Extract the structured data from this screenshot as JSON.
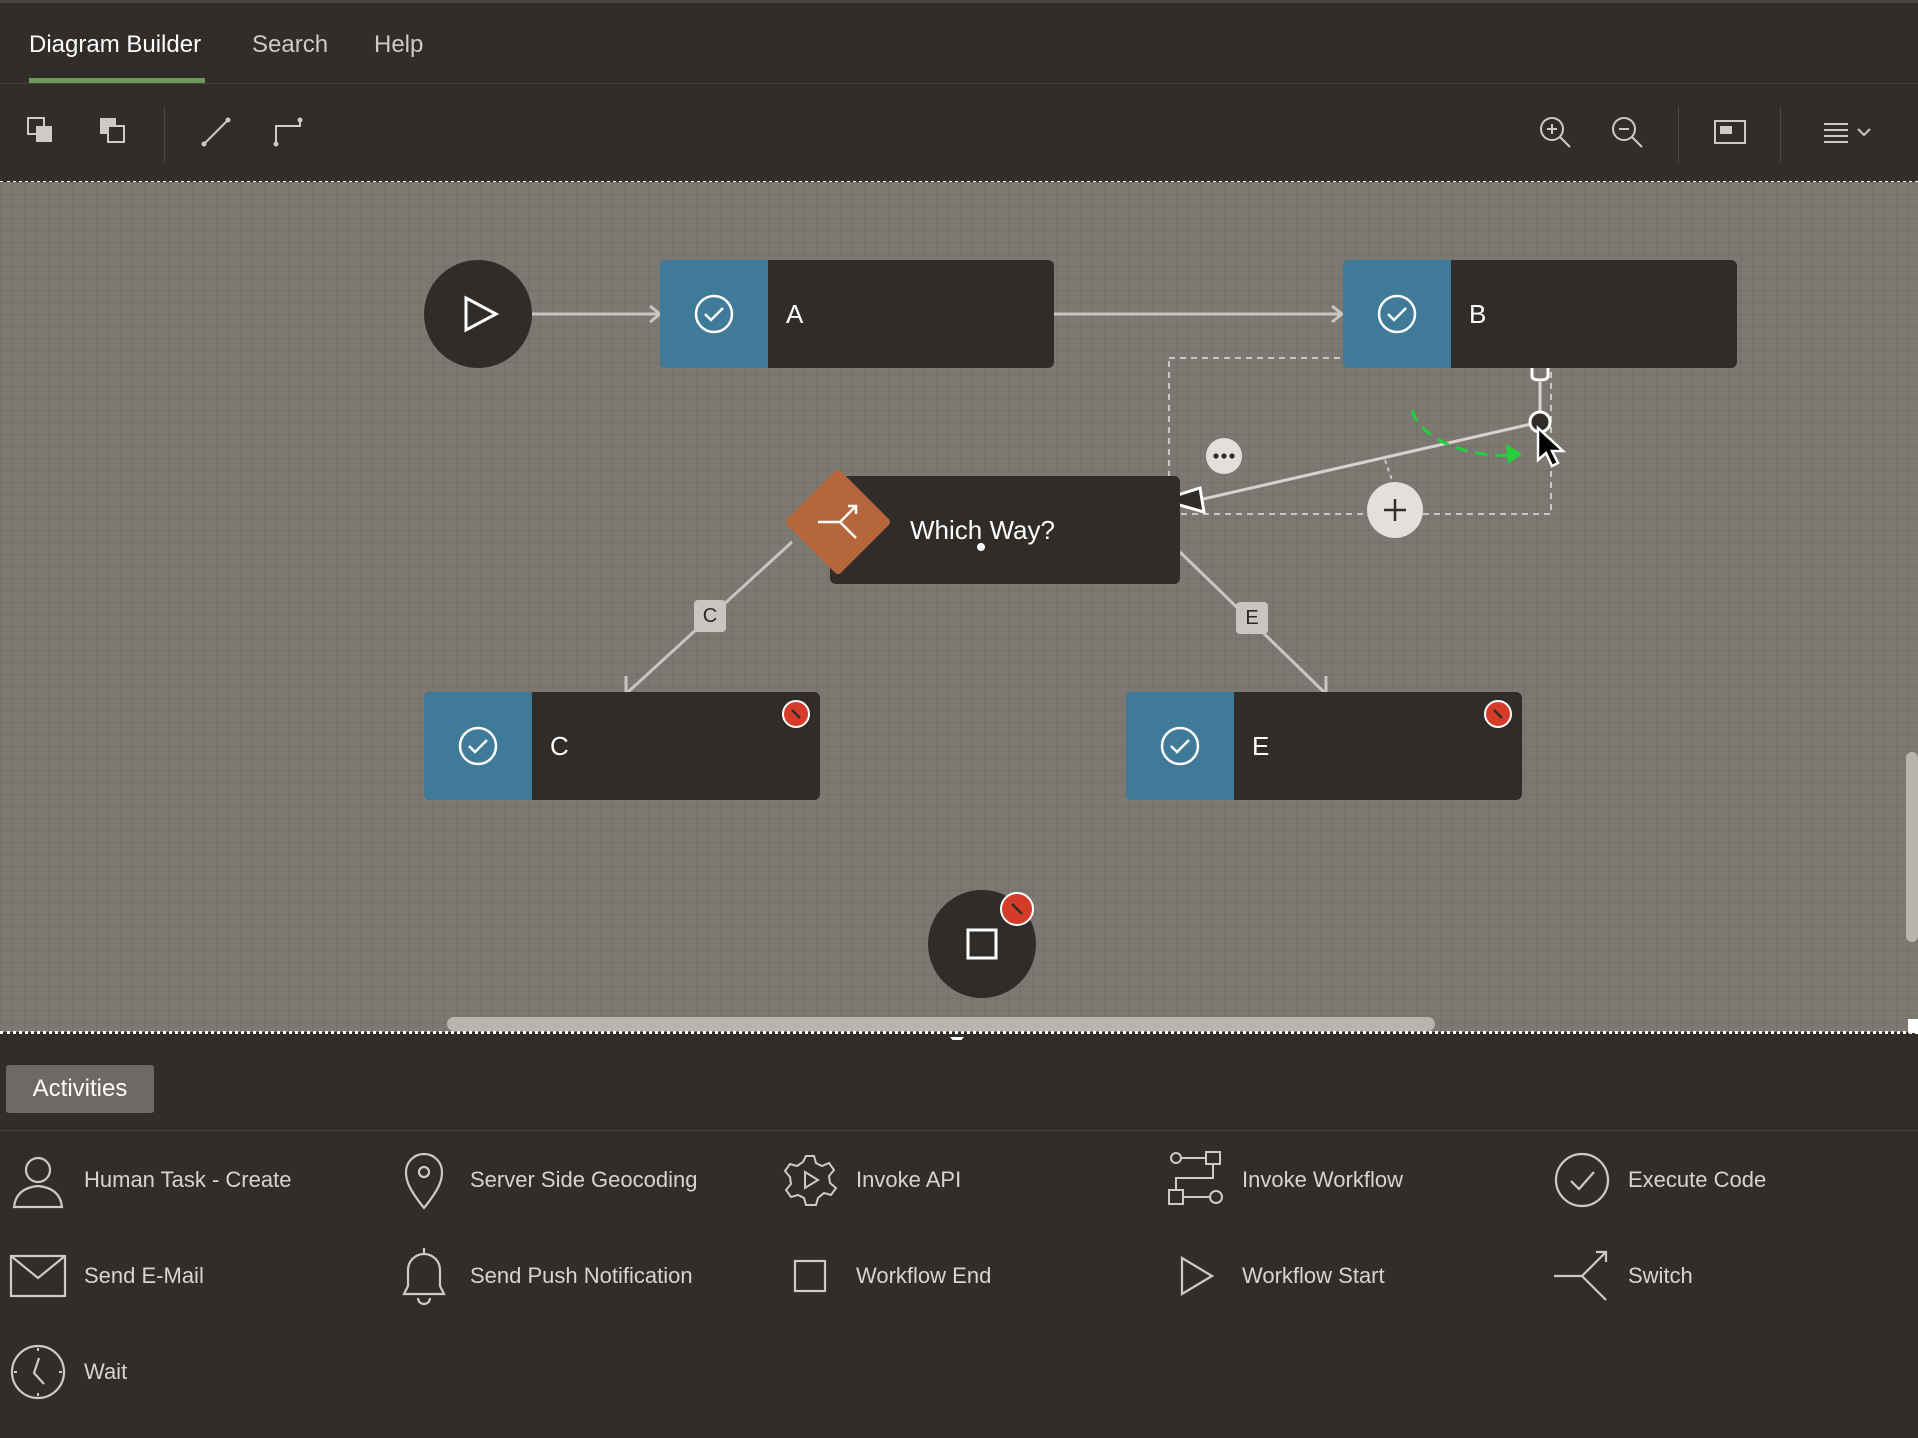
{
  "tabs": [
    {
      "label": "Diagram Builder",
      "active": true
    },
    {
      "label": "Search",
      "active": false
    },
    {
      "label": "Help",
      "active": false
    }
  ],
  "toolbar": {
    "left_icons": [
      "bring-forward-icon",
      "send-backward-icon",
      "straight-connector-icon",
      "elbow-connector-icon"
    ],
    "right_icons": [
      "zoom-in-icon",
      "zoom-out-icon",
      "fit-view-icon",
      "menu-icon"
    ]
  },
  "diagram": {
    "nodes": {
      "start": {
        "type": "workflow-start"
      },
      "a": {
        "label": "A"
      },
      "b": {
        "label": "B"
      },
      "switch": {
        "label": "Which Way?"
      },
      "c": {
        "label": "C",
        "error": true
      },
      "e": {
        "label": "E",
        "error": true
      },
      "end": {
        "type": "workflow-end",
        "error": true
      }
    },
    "edge_labels": {
      "c": "C",
      "e": "E"
    }
  },
  "panel": {
    "tab_label": "Activities",
    "activities": [
      {
        "label": "Human Task - Create",
        "icon": "person-icon"
      },
      {
        "label": "Server Side Geocoding",
        "icon": "map-pin-icon"
      },
      {
        "label": "Invoke API",
        "icon": "gear-icon"
      },
      {
        "label": "Invoke Workflow",
        "icon": "workflow-icon"
      },
      {
        "label": "Execute Code",
        "icon": "check-circle-icon"
      },
      {
        "label": "Send E-Mail",
        "icon": "envelope-icon"
      },
      {
        "label": "Send Push Notification",
        "icon": "bell-icon"
      },
      {
        "label": "Workflow End",
        "icon": "square-icon"
      },
      {
        "label": "Workflow Start",
        "icon": "play-icon"
      },
      {
        "label": "Switch",
        "icon": "switch-icon"
      },
      {
        "label": "Wait",
        "icon": "clock-icon"
      }
    ]
  },
  "colors": {
    "background": "#312d2a",
    "canvas": "#7d7872",
    "activity_accent": "#3f7b98",
    "switch_accent": "#b5673b",
    "error": "#d63b2a",
    "tab_underline": "#6c9a5a",
    "drag_path": "#22d13a"
  }
}
